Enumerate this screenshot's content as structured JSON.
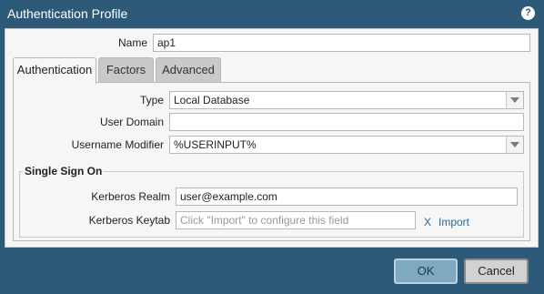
{
  "window": {
    "title": "Authentication Profile",
    "help_icon": "?"
  },
  "name_field": {
    "label": "Name",
    "value": "ap1"
  },
  "tabs": [
    {
      "label": "Authentication",
      "active": true
    },
    {
      "label": "Factors",
      "active": false
    },
    {
      "label": "Advanced",
      "active": false
    }
  ],
  "authentication": {
    "type": {
      "label": "Type",
      "value": "Local Database"
    },
    "user_domain": {
      "label": "User Domain",
      "value": ""
    },
    "username_modifier": {
      "label": "Username Modifier",
      "value": "%USERINPUT%"
    }
  },
  "sso": {
    "title": "Single Sign On",
    "kerberos_realm": {
      "label": "Kerberos Realm",
      "value": "user@example.com"
    },
    "kerberos_keytab": {
      "label": "Kerberos Keytab",
      "placeholder": "Click \"Import\" to configure this field",
      "clear_label": "X",
      "import_label": "Import"
    }
  },
  "buttons": {
    "ok": "OK",
    "cancel": "Cancel"
  },
  "colors": {
    "title_bar": "#2e5a7a",
    "panel_bg": "#f6f6f6",
    "link": "#2e6a95",
    "ok_button": "#7fa9c1",
    "cancel_button": "#d2d2d2"
  }
}
